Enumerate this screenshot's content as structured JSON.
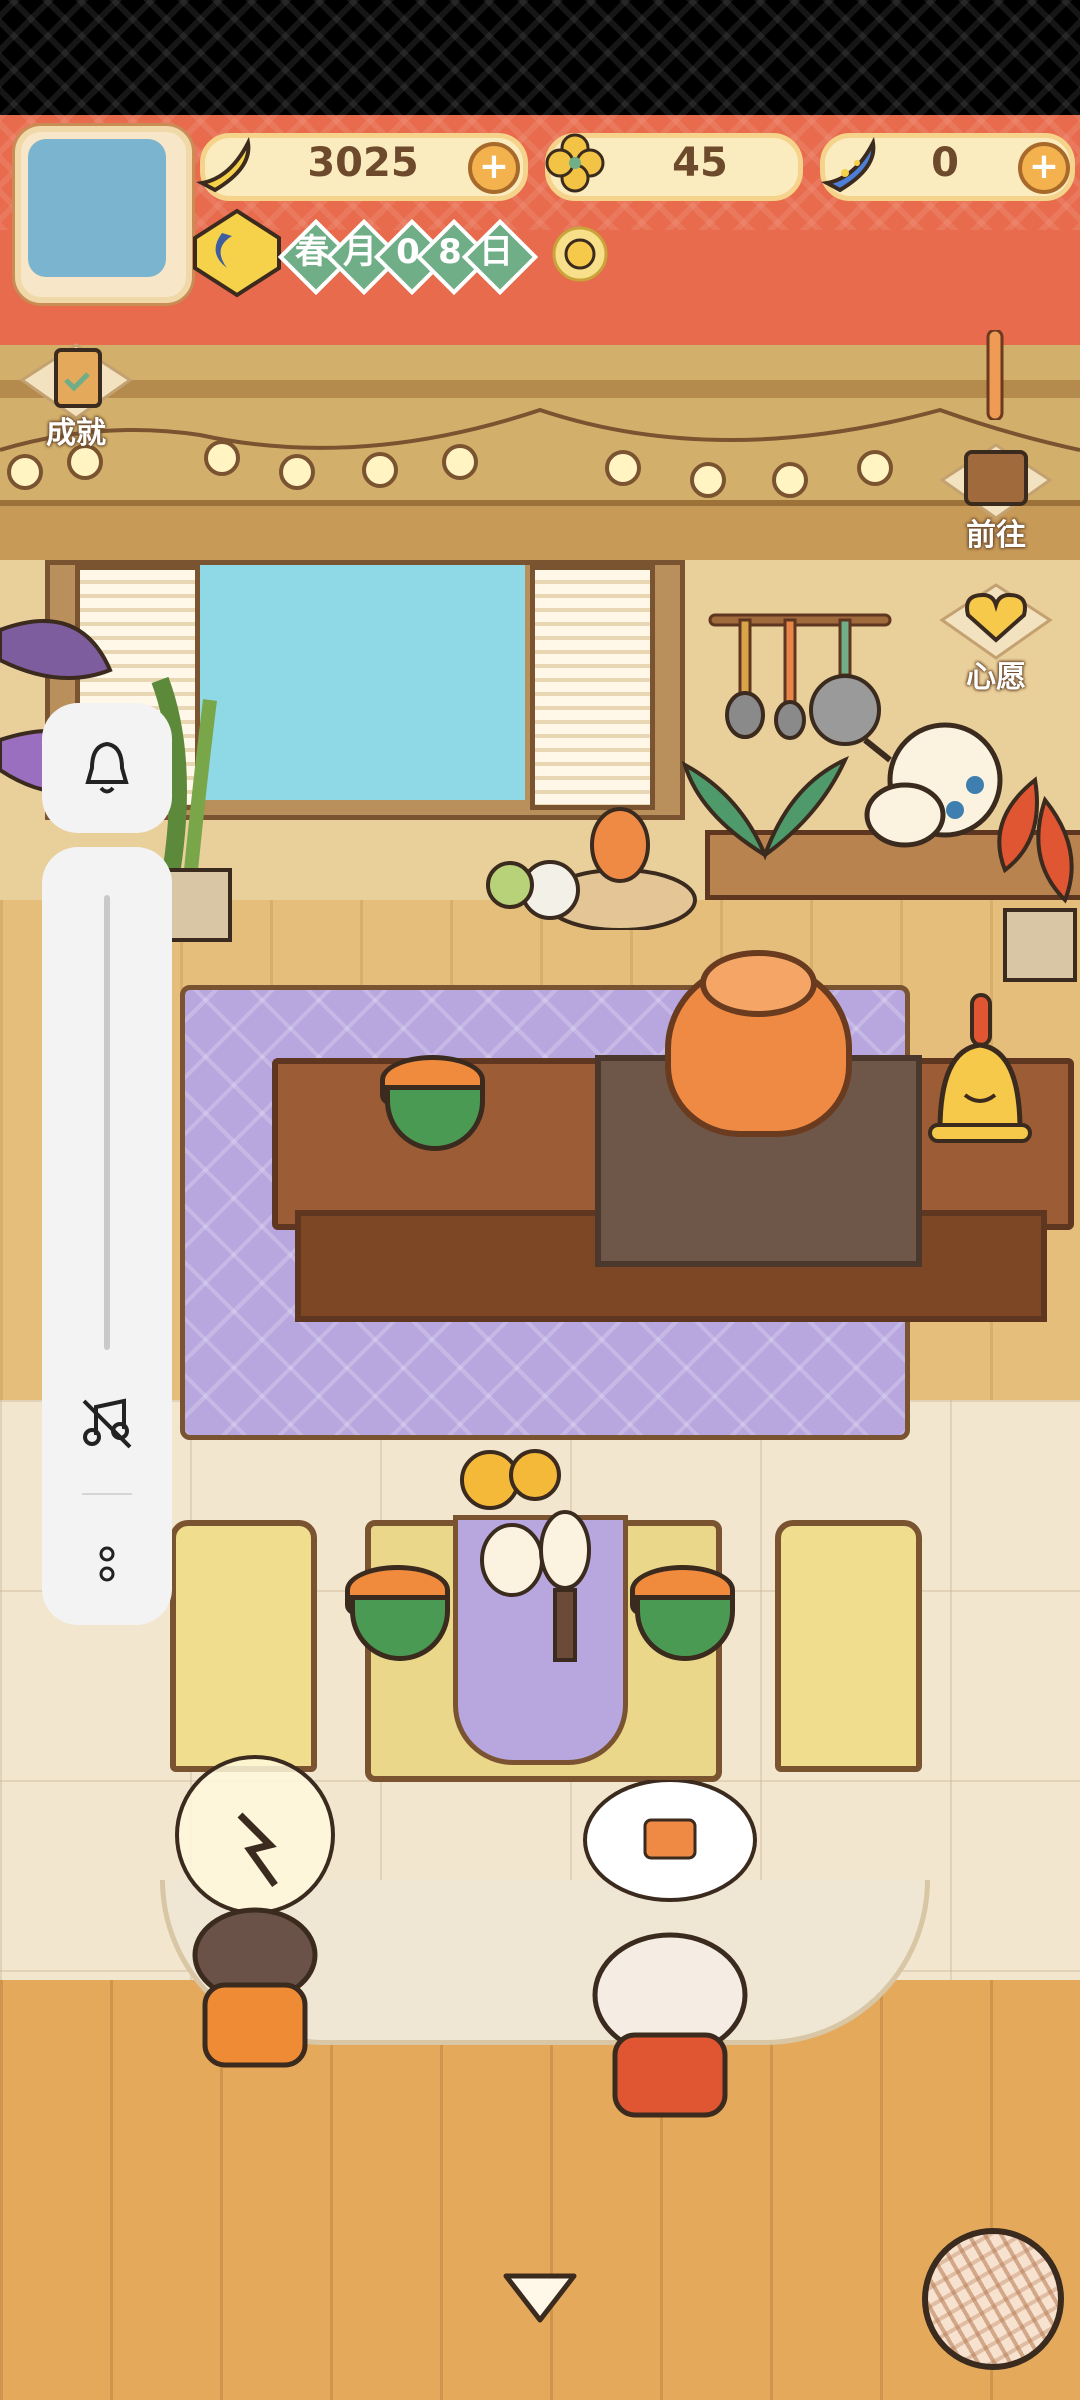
{
  "hud": {
    "currencies": [
      {
        "icon": "banana-icon",
        "value": "3025",
        "has_add": true
      },
      {
        "icon": "clover-icon",
        "value": "45",
        "has_add": false
      },
      {
        "icon": "blue-banana-icon",
        "value": "0",
        "has_add": true
      }
    ],
    "date": {
      "season": "春",
      "month": "月",
      "day_digit_1": "0",
      "day_digit_2": "8",
      "day_suffix": "日"
    },
    "add_symbol": "+"
  },
  "side_menu": {
    "achievements_label": "成就",
    "goto_label": "前往",
    "wish_label": "心愿"
  },
  "colors": {
    "awning": "#e86b4d",
    "accent_gold": "#f3b24d",
    "date_green": "#6fae86",
    "rug_lavender": "#b7a7de"
  },
  "icons": {
    "bell": "bell-icon",
    "music_off": "music-off-icon",
    "more": "more-vertical-icon",
    "down_arrow": "chevron-down-icon",
    "yarn": "yarn-ball-icon"
  }
}
